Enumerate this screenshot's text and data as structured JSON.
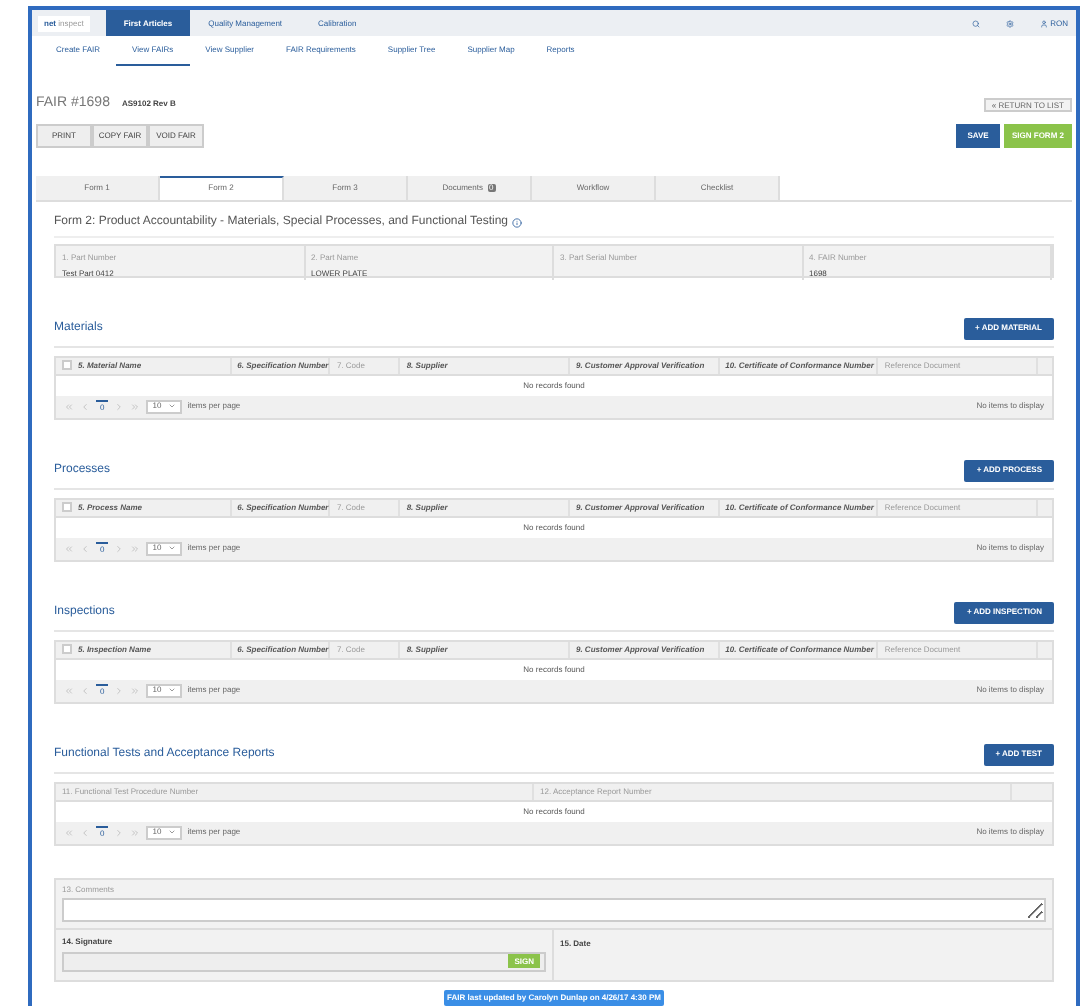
{
  "app_bar": {
    "logo": {
      "brand": "net",
      "product": "inspect"
    },
    "modules": [
      {
        "label": "First Articles",
        "selected": true
      },
      {
        "label": "Quality Management",
        "selected": false
      },
      {
        "label": "Calibration",
        "selected": false
      }
    ],
    "user": "RON"
  },
  "sub_nav": [
    {
      "label": "Create FAIR",
      "selected": false
    },
    {
      "label": "View FAIRs",
      "selected": true
    },
    {
      "label": "View Supplier",
      "selected": false
    },
    {
      "label": "FAIR Requirements",
      "selected": false
    },
    {
      "label": "Supplier Tree",
      "selected": false
    },
    {
      "label": "Supplier Map",
      "selected": false
    },
    {
      "label": "Reports",
      "selected": false
    }
  ],
  "record": {
    "title": "FAIR #1698",
    "standard": "AS9102 Rev B",
    "actions": [
      "PRINT",
      "COPY FAIR",
      "VOID FAIR"
    ],
    "return_link": "« RETURN TO LIST",
    "save": "SAVE",
    "sign": "SIGN FORM 2"
  },
  "form_tabs": [
    {
      "label": "Form 1",
      "selected": false
    },
    {
      "label": "Form 2",
      "selected": true
    },
    {
      "label": "Form 3",
      "selected": false
    },
    {
      "label": "Documents",
      "selected": false,
      "badge": "0"
    },
    {
      "label": "Workflow",
      "selected": false
    },
    {
      "label": "Checklist",
      "selected": false
    }
  ],
  "form_title": "Form 2: Product Accountability - Materials, Special Processes, and Functional Testing",
  "fields": [
    {
      "label": "1. Part Number",
      "value": "Test Part 0412"
    },
    {
      "label": "2. Part Name",
      "value": "LOWER PLATE"
    },
    {
      "label": "3. Part Serial Number"
    },
    {
      "label": "4. FAIR Number",
      "value": "1698"
    }
  ],
  "sections": [
    {
      "title": "Materials",
      "button": "+ ADD MATERIAL",
      "columns": [
        {
          "label": "5. Material Name",
          "kind": "bold"
        },
        {
          "label": "6. Specification Number",
          "kind": "bold"
        },
        {
          "label": "7. Code",
          "kind": "plain"
        },
        {
          "label": "8. Supplier",
          "kind": "bold"
        },
        {
          "label": "9. Customer Approval Verification",
          "kind": "bold"
        },
        {
          "label": "10. Certificate of Conformance Number",
          "kind": "bold"
        },
        {
          "label": "Reference Document",
          "kind": "plain"
        }
      ],
      "select_all": {
        "checked": false
      },
      "empty": "No records found",
      "pager": {
        "page": "0",
        "page_size": "10",
        "per_page": "items per page",
        "status": "No items to display"
      }
    },
    {
      "title": "Processes",
      "button": "+ ADD PROCESS",
      "columns": [
        {
          "label": "5. Process Name",
          "kind": "bold"
        },
        {
          "label": "6. Specification Number",
          "kind": "bold"
        },
        {
          "label": "7. Code",
          "kind": "plain"
        },
        {
          "label": "8. Supplier",
          "kind": "bold"
        },
        {
          "label": "9. Customer Approval Verification",
          "kind": "bold"
        },
        {
          "label": "10. Certificate of Conformance Number",
          "kind": "bold"
        },
        {
          "label": "Reference Document",
          "kind": "plain"
        }
      ],
      "select_all": {
        "checked": false
      },
      "empty": "No records found",
      "pager": {
        "page": "0",
        "page_size": "10",
        "per_page": "items per page",
        "status": "No items to display"
      }
    },
    {
      "title": "Inspections",
      "button": "+ ADD INSPECTION",
      "columns": [
        {
          "label": "5. Inspection Name",
          "kind": "bold"
        },
        {
          "label": "6. Specification Number",
          "kind": "bold"
        },
        {
          "label": "7. Code",
          "kind": "plain"
        },
        {
          "label": "8. Supplier",
          "kind": "bold"
        },
        {
          "label": "9. Customer Approval Verification",
          "kind": "bold"
        },
        {
          "label": "10. Certificate of Conformance Number",
          "kind": "bold"
        },
        {
          "label": "Reference Document",
          "kind": "plain"
        }
      ],
      "select_all": {
        "checked": false
      },
      "empty": "No records found",
      "pager": {
        "page": "0",
        "page_size": "10",
        "per_page": "items per page",
        "status": "No items to display"
      }
    },
    {
      "title": "Functional Tests and Acceptance Reports",
      "button": "+ ADD TEST",
      "columns": [
        {
          "label": "11. Functional Test Procedure Number",
          "kind": "plain"
        },
        {
          "label": "12. Acceptance Report Number",
          "kind": "plain"
        }
      ],
      "empty": "No records found",
      "pager": {
        "page": "0",
        "page_size": "10",
        "per_page": "items per page",
        "status": "No items to display"
      }
    }
  ],
  "comments": {
    "label": "13. Comments"
  },
  "signature": {
    "label": "14. Signature",
    "button": "SIGN"
  },
  "date": {
    "label": "15. Date"
  },
  "footer_note": "FAIR last updated by Carolyn Dunlap on 4/26/17 4:30 PM"
}
